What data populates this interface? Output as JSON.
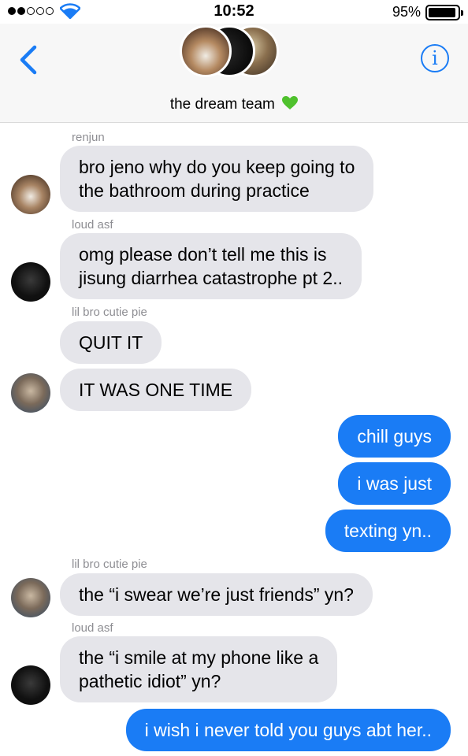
{
  "status": {
    "time": "10:52",
    "battery_percent_label": "95%",
    "battery_level": 0.95,
    "signal_bars_filled": 2,
    "signal_bars_total": 5
  },
  "header": {
    "title": "the dream team",
    "title_emoji": "green-heart-icon",
    "back_icon": "chevron-left-icon",
    "info_icon": "info-icon",
    "info_glyph": "i"
  },
  "messages": [
    {
      "sender": "renjun",
      "direction": "in",
      "text": [
        "bro jeno why do you keep going to",
        "the bathroom during practice"
      ]
    },
    {
      "sender": "loud asf",
      "direction": "in",
      "text": [
        "omg please don’t tell me this is",
        "jisung diarrhea catastrophe pt 2.."
      ]
    },
    {
      "sender": "lil bro cutie pie",
      "direction": "in",
      "text": [
        "QUIT IT"
      ]
    },
    {
      "sender": "",
      "direction": "in",
      "text": [
        "IT WAS ONE TIME"
      ]
    },
    {
      "sender": "",
      "direction": "out",
      "text": [
        "chill guys"
      ]
    },
    {
      "sender": "",
      "direction": "out",
      "text": [
        "i was just"
      ]
    },
    {
      "sender": "",
      "direction": "out",
      "text": [
        "texting yn.."
      ]
    },
    {
      "sender": "lil bro cutie pie",
      "direction": "in",
      "text": [
        "the “i swear we’re just friends” yn?"
      ]
    },
    {
      "sender": "loud asf",
      "direction": "in",
      "text": [
        "the “i smile at my phone like a",
        "pathetic idiot” yn?"
      ]
    },
    {
      "sender": "",
      "direction": "out",
      "text": [
        "i wish i never told you guys abt her.."
      ]
    }
  ],
  "colors": {
    "outgoing_bubble": "#1a7cf5",
    "incoming_bubble": "#e5e5ea",
    "sender_label": "#8e8e93",
    "accent": "#1a7cf5"
  }
}
